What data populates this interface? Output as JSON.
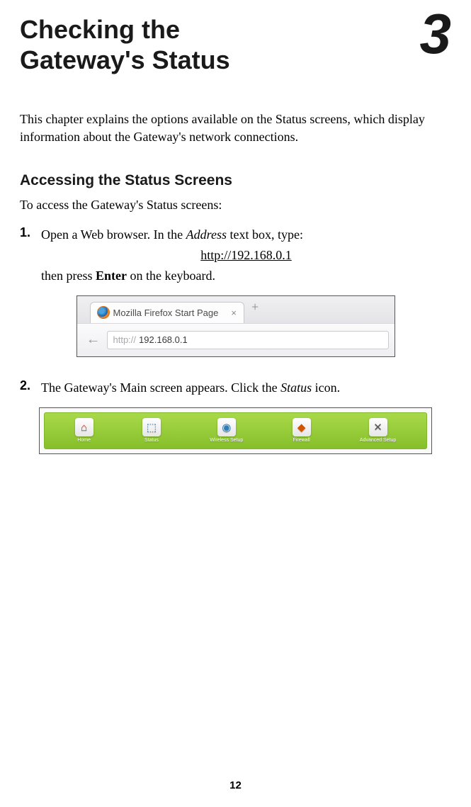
{
  "chapter": {
    "title": "Checking the Gateway's Status",
    "number": "3"
  },
  "intro": "This chapter explains the options available on the Status screens, which display information about the Gateway's network connections.",
  "section": {
    "heading": "Accessing the Status Screens",
    "intro": "To access the Gateway's Status screens:"
  },
  "step1": {
    "num": "1.",
    "text_a": "Open a Web browser. In the ",
    "text_a_italic": "Address",
    "text_a_end": " text box, type:",
    "url": "http://192.168.0.1",
    "text_b_start": "then press ",
    "text_b_bold": "Enter",
    "text_b_end": " on the keyboard."
  },
  "browser_figure": {
    "tab_title": "Mozilla Firefox Start Page",
    "url_scheme": "http://",
    "url_host": "192.168.0.1"
  },
  "step2": {
    "num": "2.",
    "text_a": "The Gateway's Main screen appears. Click the ",
    "text_italic": "Status",
    "text_end": " icon."
  },
  "nav_figure": {
    "items": [
      {
        "label": "Home"
      },
      {
        "label": "Status"
      },
      {
        "label": "Wireless Setup"
      },
      {
        "label": "Firewall"
      },
      {
        "label": "Advanced Setup"
      }
    ]
  },
  "page_number": "12"
}
